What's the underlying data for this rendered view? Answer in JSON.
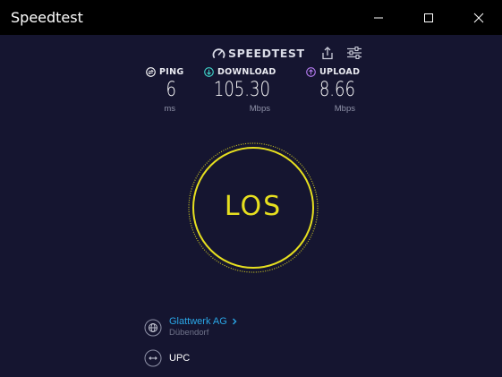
{
  "window": {
    "title": "Speedtest"
  },
  "header": {
    "brand": "SPEEDTEST"
  },
  "metrics": {
    "ping": {
      "label": "PING",
      "value": "6",
      "unit": "ms",
      "icon": "ping-icon",
      "color": "#ffffff"
    },
    "download": {
      "label": "DOWNLOAD",
      "value": "105.30",
      "unit": "Mbps",
      "icon": "download-icon",
      "color": "#3fd3c8"
    },
    "upload": {
      "label": "UPLOAD",
      "value": "8.66",
      "unit": "Mbps",
      "icon": "upload-icon",
      "color": "#b57cf0"
    }
  },
  "go_button": {
    "label": "LOS",
    "color": "#e6df1f"
  },
  "isp": {
    "name": "Glattwerk AG",
    "location": "Dübendorf",
    "link_color": "#2aa6e6"
  },
  "server": {
    "name": "UPC"
  },
  "colors": {
    "background": "#151530",
    "titlebar": "#000000"
  }
}
